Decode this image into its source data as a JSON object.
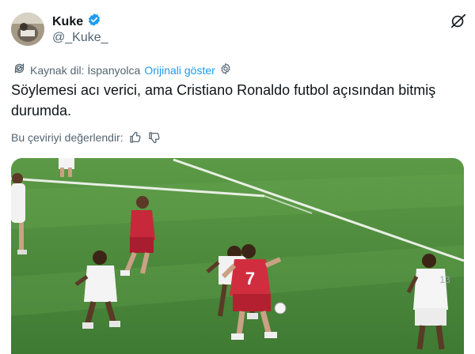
{
  "author": {
    "display_name": "Kuke",
    "handle": "@_Kuke_",
    "verified_icon": "verified-badge-icon",
    "avatar_icon": "avatar"
  },
  "actions": {
    "grok_icon": "grok-icon"
  },
  "translation": {
    "source_label": "Kaynak dil: İspanyolca",
    "show_original": "Orijinali göster",
    "icon": "translate-icon",
    "settings_icon": "gear-icon"
  },
  "tweet": {
    "text": "Söylemesi acı verici, ama Cristiano Ronaldo futbol açısından bitmiş durumda."
  },
  "rate": {
    "label": "Bu çeviriyi değerlendir:",
    "up_icon": "thumbs-up-icon",
    "down_icon": "thumbs-down-icon"
  },
  "media": {
    "type": "image",
    "description_icon": "soccer-match-photo",
    "jersey_number": "7",
    "jersey_number_other": "13"
  },
  "colors": {
    "accent": "#1d9bf0",
    "secondary_text": "#536471",
    "pitch_green": "#4e8a3c"
  }
}
